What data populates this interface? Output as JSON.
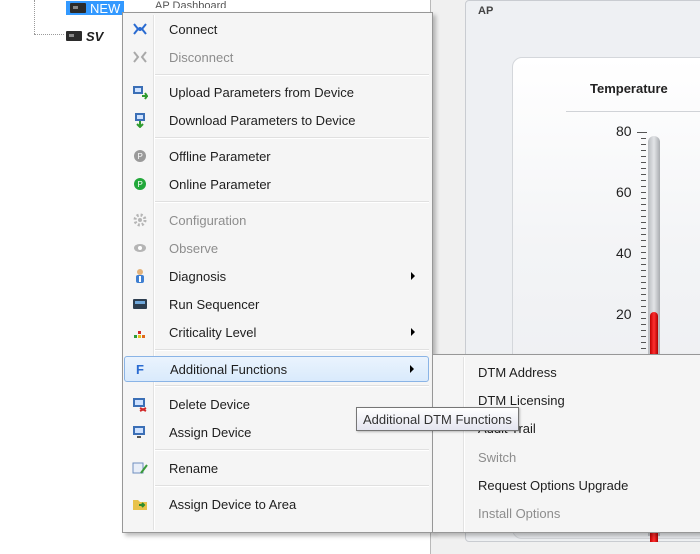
{
  "tree": {
    "selected_node": "NEW",
    "second_node": "SV",
    "header_fragment": "AP Dashboard"
  },
  "panel": {
    "frame_label": "AP",
    "gauge_title": "Temperature",
    "scale_labels": [
      "80",
      "60",
      "40",
      "20"
    ],
    "current_value_fraction": 0.2
  },
  "menu": {
    "items": [
      {
        "label": "Connect",
        "icon": "connect-icon",
        "enabled": true
      },
      {
        "label": "Disconnect",
        "icon": "disconnect-icon",
        "enabled": false
      },
      {
        "label": "Upload Parameters from Device",
        "icon": "upload-icon",
        "enabled": true
      },
      {
        "label": "Download Parameters to Device",
        "icon": "download-icon",
        "enabled": true
      },
      {
        "label": "Offline Parameter",
        "icon": "offline-parameter-icon",
        "enabled": true
      },
      {
        "label": "Online Parameter",
        "icon": "online-parameter-icon",
        "enabled": true
      },
      {
        "label": "Configuration",
        "icon": "configuration-icon",
        "enabled": false
      },
      {
        "label": "Observe",
        "icon": "observe-icon",
        "enabled": false
      },
      {
        "label": "Diagnosis",
        "icon": "diagnosis-icon",
        "enabled": true,
        "submenu": true
      },
      {
        "label": "Run Sequencer",
        "icon": "sequencer-icon",
        "enabled": true
      },
      {
        "label": "Criticality Level",
        "icon": "criticality-icon",
        "enabled": true,
        "submenu": true
      },
      {
        "label": "Additional Functions",
        "icon": "function-icon",
        "enabled": true,
        "submenu": true,
        "highlighted": true
      },
      {
        "label": "Delete Device",
        "icon": "delete-device-icon",
        "enabled": true
      },
      {
        "label": "Assign Device",
        "icon": "assign-device-icon",
        "enabled": true
      },
      {
        "label": "Rename",
        "icon": "rename-icon",
        "enabled": true
      },
      {
        "label": "Assign Device to Area",
        "icon": "area-folder-icon",
        "enabled": true
      }
    ]
  },
  "submenu": {
    "items": [
      {
        "label": "DTM Address",
        "enabled": true
      },
      {
        "label": "DTM Licensing",
        "enabled": true
      },
      {
        "label": "Audit Trail",
        "enabled": true
      },
      {
        "label": "Switch",
        "enabled": false
      },
      {
        "label": "Request Options Upgrade",
        "enabled": true
      },
      {
        "label": "Install Options",
        "enabled": false
      }
    ]
  },
  "tooltip": {
    "text": "Additional DTM Functions"
  }
}
